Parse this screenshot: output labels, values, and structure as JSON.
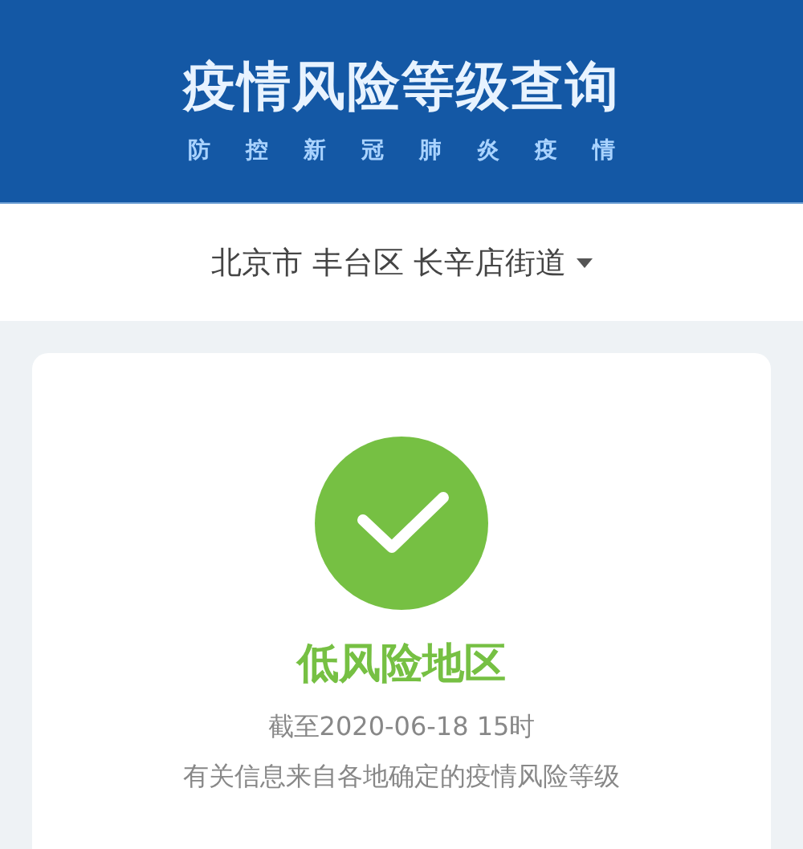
{
  "header": {
    "title": "疫情风险等级查询",
    "subtitle": [
      "防",
      "控",
      "新",
      "冠",
      "肺",
      "炎",
      "疫",
      "情"
    ]
  },
  "location": {
    "text": "北京市 丰台区 长辛店街道"
  },
  "result": {
    "kind": "low",
    "level_text": "低风险地区",
    "as_of": "截至2020-06-18 15时",
    "note": "有关信息来自各地确定的疫情风险等级"
  }
}
